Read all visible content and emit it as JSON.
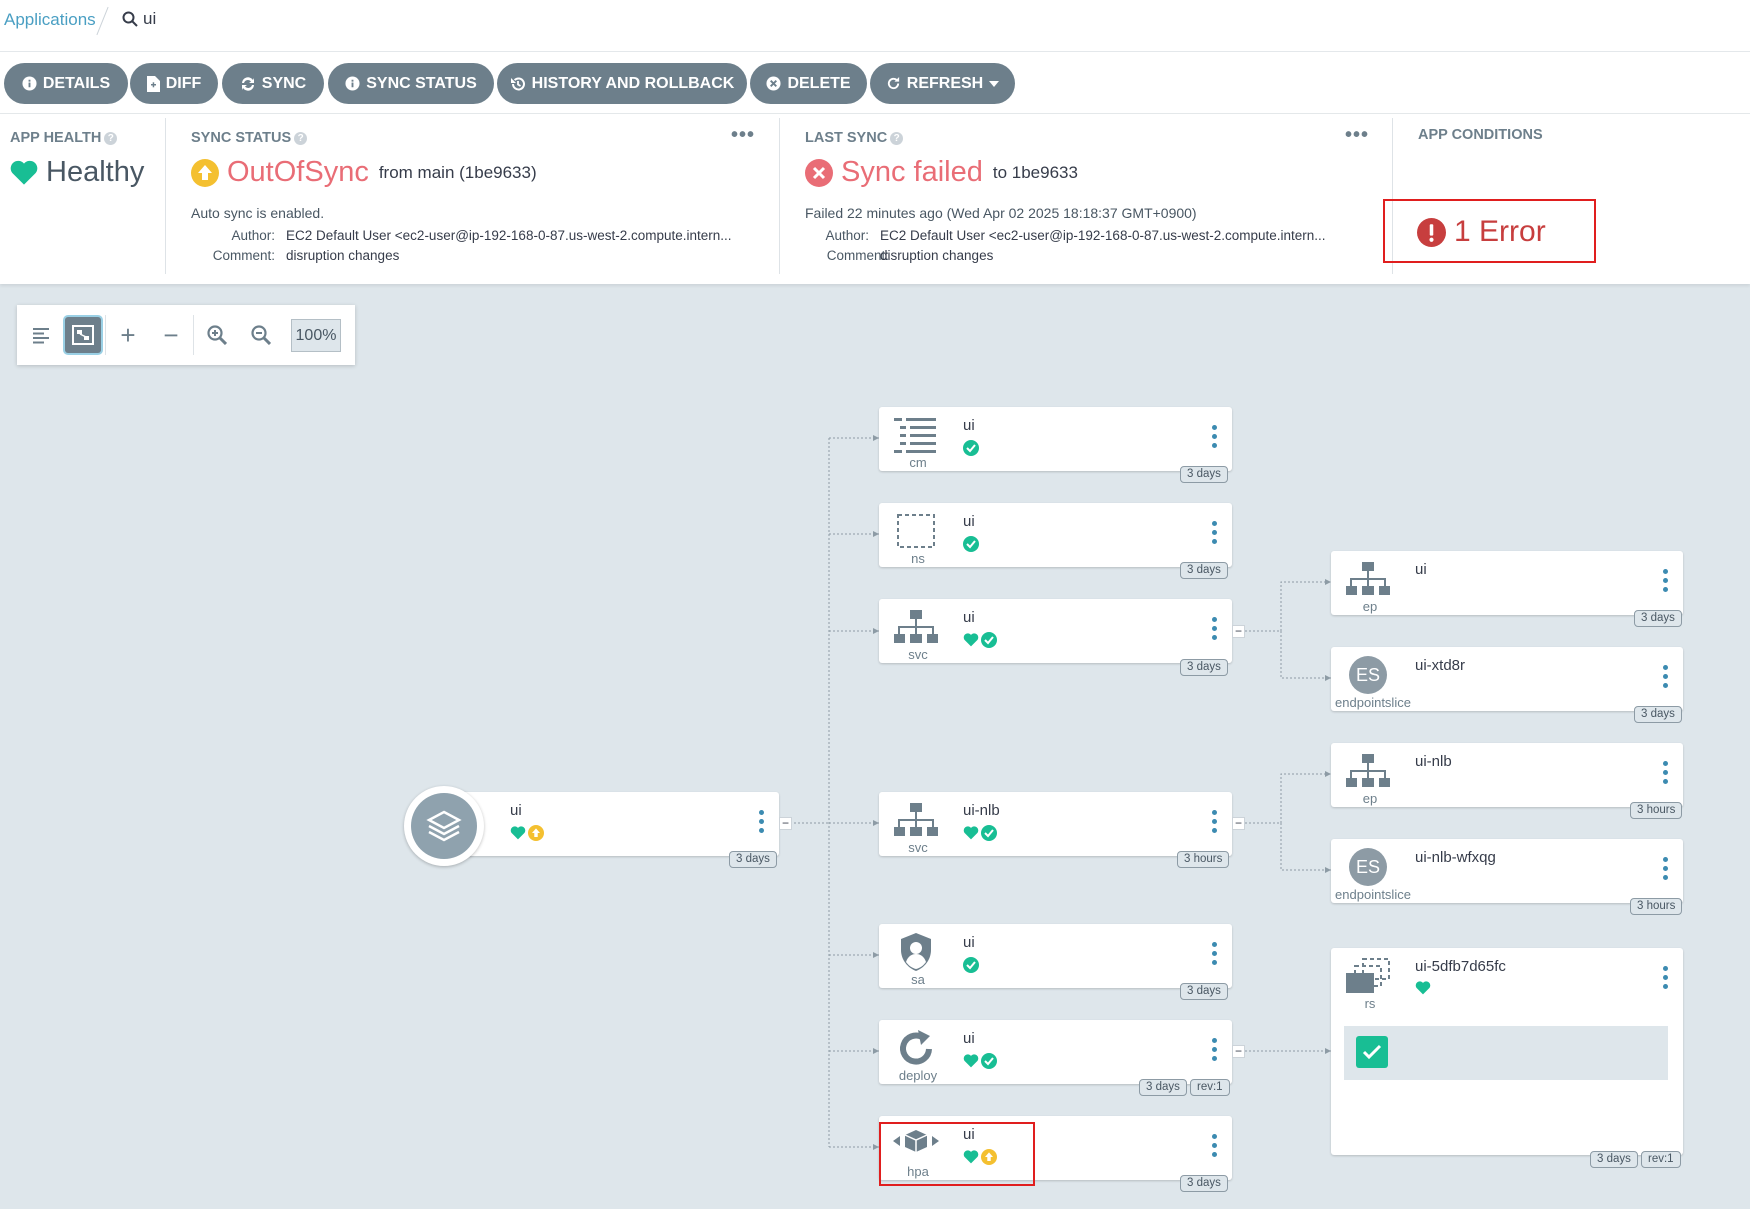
{
  "breadcrumb": {
    "link": "Applications",
    "search": "ui"
  },
  "toolbar": {
    "details": "DETAILS",
    "diff": "DIFF",
    "sync": "SYNC",
    "sync_status": "SYNC STATUS",
    "history": "HISTORY AND ROLLBACK",
    "delete": "DELETE",
    "refresh": "REFRESH"
  },
  "app_health": {
    "title": "APP HEALTH",
    "value": "Healthy"
  },
  "sync_status": {
    "title": "SYNC STATUS",
    "value": "OutOfSync",
    "from": "from main (1be9633)",
    "auto": "Auto sync is enabled.",
    "author_label": "Author:",
    "author": "EC2 Default User <ec2-user@ip-192-168-0-87.us-west-2.compute.intern...",
    "comment_label": "Comment:",
    "comment": "disruption changes"
  },
  "last_sync": {
    "title": "LAST SYNC",
    "value": "Sync failed",
    "to": "to 1be9633",
    "failed": "Failed 22 minutes ago (Wed Apr 02 2025 18:18:37 GMT+0900)",
    "author_label": "Author:",
    "author": "EC2 Default User <ec2-user@ip-192-168-0-87.us-west-2.compute.intern...",
    "comment_label": "Comment:",
    "comment": "disruption changes"
  },
  "app_conditions": {
    "title": "APP CONDITIONS",
    "value": "1 Error"
  },
  "graph": {
    "zoom": "100%"
  },
  "colors": {
    "healthy": "#18be94",
    "outofsync": "#f4c030",
    "failed": "#e96d76",
    "error": "#c73e3e",
    "link": "#3c8bb1"
  },
  "nodes": {
    "root": {
      "name": "ui",
      "age": "3 days"
    },
    "cm": {
      "kind": "cm",
      "name": "ui",
      "age": "3 days"
    },
    "ns": {
      "kind": "ns",
      "name": "ui",
      "age": "3 days"
    },
    "svc1": {
      "kind": "svc",
      "name": "ui",
      "age": "3 days"
    },
    "svc2": {
      "kind": "svc",
      "name": "ui-nlb",
      "age": "3 hours"
    },
    "sa": {
      "kind": "sa",
      "name": "ui",
      "age": "3 days"
    },
    "deploy": {
      "kind": "deploy",
      "name": "ui",
      "age": "3 days",
      "rev": "rev:1"
    },
    "hpa": {
      "kind": "hpa",
      "name": "ui",
      "age": "3 days"
    },
    "ep1": {
      "kind": "ep",
      "name": "ui",
      "age": "3 days"
    },
    "es1": {
      "kind": "endpointslice",
      "icon": "ES",
      "name": "ui-xtd8r",
      "age": "3 days"
    },
    "ep2": {
      "kind": "ep",
      "name": "ui-nlb",
      "age": "3 hours"
    },
    "es2": {
      "kind": "endpointslice",
      "icon": "ES",
      "name": "ui-nlb-wfxqg",
      "age": "3 hours"
    },
    "rs": {
      "kind": "rs",
      "name": "ui-5dfb7d65fc",
      "age": "3 days",
      "rev": "rev:1"
    }
  }
}
